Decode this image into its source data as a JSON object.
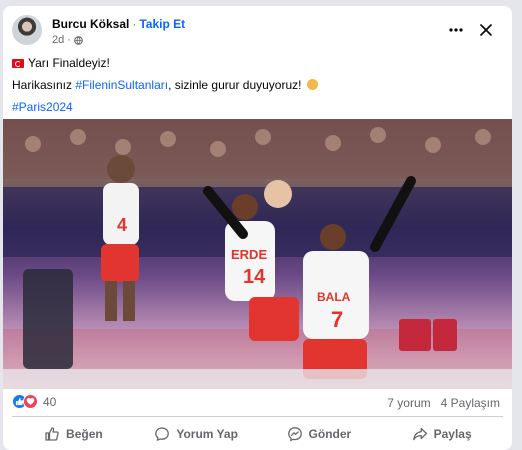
{
  "post": {
    "author": "Burcu Köksal",
    "separator": "·",
    "follow_label": "Takip Et",
    "time": "2d",
    "time_separator": "·",
    "lines": {
      "line1_text": "Yarı Finaldeyiz!",
      "line2_prefix": "Harikasınız ",
      "line2_hashtag": "#FileninSultanları",
      "line2_suffix": ", sizinle gurur duyuyoruz!",
      "line3_hashtag": "#Paris2024"
    }
  },
  "photo": {
    "jersey_numbers": [
      "4",
      "14",
      "7"
    ],
    "jersey_names": [
      "ERDE",
      "BALA"
    ]
  },
  "stats": {
    "reaction_count": "40",
    "comments": "7 yorum",
    "shares": "4 Paylaşım"
  },
  "actions": {
    "like": "Beğen",
    "comment": "Yorum Yap",
    "send": "Gönder",
    "share": "Paylaş"
  },
  "colors": {
    "accent": "#0866ff",
    "muted": "#65676b",
    "like_blue": "#1877f2",
    "love_red": "#f33e58"
  }
}
